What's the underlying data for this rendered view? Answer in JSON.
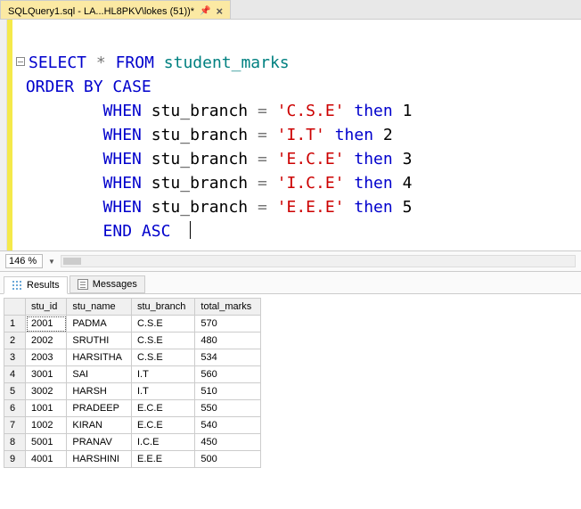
{
  "tab": {
    "title": "SQLQuery1.sql - LA...HL8PKV\\lokes (51))*"
  },
  "sql": {
    "l1_select": "SELECT",
    "l1_star": "*",
    "l1_from": "FROM",
    "l1_table": "student_marks",
    "l2_order": "ORDER",
    "l2_by": "BY",
    "l2_case": "CASE",
    "when": "WHEN",
    "col": "stu_branch",
    "eq": "=",
    "then": "then",
    "v1": "'C.S.E'",
    "n1": "1",
    "v2": "'I.T'",
    "n2": "2",
    "v3": "'E.C.E'",
    "n3": "3",
    "v4": "'I.C.E'",
    "n4": "4",
    "v5": "'E.E.E'",
    "n5": "5",
    "end": "END",
    "asc": "ASC"
  },
  "zoom": {
    "value": "146 %"
  },
  "result_tabs": {
    "results": "Results",
    "messages": "Messages"
  },
  "columns": {
    "c0": "",
    "c1": "stu_id",
    "c2": "stu_name",
    "c3": "stu_branch",
    "c4": "total_marks"
  },
  "rows": [
    {
      "n": "1",
      "id": "2001",
      "name": "PADMA",
      "branch": "C.S.E",
      "marks": "570"
    },
    {
      "n": "2",
      "id": "2002",
      "name": "SRUTHI",
      "branch": "C.S.E",
      "marks": "480"
    },
    {
      "n": "3",
      "id": "2003",
      "name": "HARSITHA",
      "branch": "C.S.E",
      "marks": "534"
    },
    {
      "n": "4",
      "id": "3001",
      "name": "SAI",
      "branch": "I.T",
      "marks": "560"
    },
    {
      "n": "5",
      "id": "3002",
      "name": "HARSH",
      "branch": "I.T",
      "marks": "510"
    },
    {
      "n": "6",
      "id": "1001",
      "name": "PRADEEP",
      "branch": "E.C.E",
      "marks": "550"
    },
    {
      "n": "7",
      "id": "1002",
      "name": "KIRAN",
      "branch": "E.C.E",
      "marks": "540"
    },
    {
      "n": "8",
      "id": "5001",
      "name": "PRANAV",
      "branch": "I.C.E",
      "marks": "450"
    },
    {
      "n": "9",
      "id": "4001",
      "name": "HARSHINI",
      "branch": "E.E.E",
      "marks": "500"
    }
  ]
}
